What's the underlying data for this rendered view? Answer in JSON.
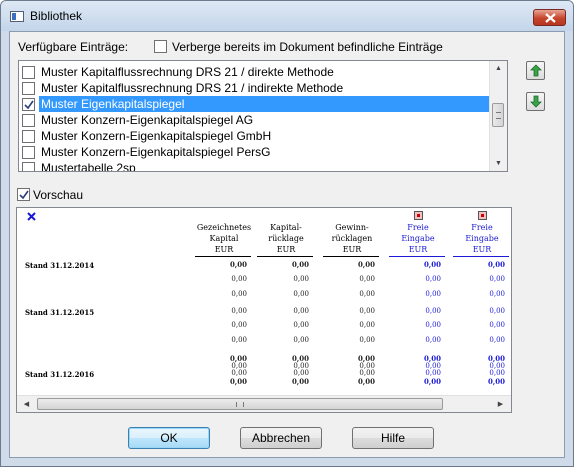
{
  "window": {
    "title": "Bibliothek"
  },
  "header": {
    "available_label": "Verfügbare Einträge:",
    "hide_label": "Verberge bereits im Dokument befindliche Einträge",
    "hide_checked": false
  },
  "list": {
    "items": [
      {
        "label": "Muster Kapitalflussrechnung DRS 21 / direkte Methode",
        "checked": false,
        "selected": false
      },
      {
        "label": "Muster Kapitalflussrechnung DRS 21 / indirekte Methode",
        "checked": false,
        "selected": false
      },
      {
        "label": "Muster Eigenkapitalspiegel",
        "checked": true,
        "selected": true
      },
      {
        "label": "Muster Konzern-Eigenkapitalspiegel AG",
        "checked": false,
        "selected": false
      },
      {
        "label": "Muster Konzern-Eigenkapitalspiegel GmbH",
        "checked": false,
        "selected": false
      },
      {
        "label": "Muster Konzern-Eigenkapitalspiegel PersG",
        "checked": false,
        "selected": false
      },
      {
        "label": "Mustertabelle 2sp",
        "checked": false,
        "selected": false
      }
    ]
  },
  "preview": {
    "label": "Vorschau",
    "checked": true,
    "columns": [
      {
        "l1": "Gezeichnetes",
        "l2": "Kapital",
        "unit": "EUR",
        "blue": false
      },
      {
        "l1": "Kapital-",
        "l2": "rücklage",
        "unit": "EUR",
        "blue": false
      },
      {
        "l1": "Gewinn-",
        "l2": "rücklagen",
        "unit": "EUR",
        "blue": false
      },
      {
        "l1": "Freie",
        "l2": "Eingabe",
        "unit": "EUR",
        "blue": true
      },
      {
        "l1": "Freie",
        "l2": "Eingabe",
        "unit": "EUR",
        "blue": true
      }
    ],
    "row_labels": [
      "Stand 31.12.2014",
      "Stand 31.12.2015",
      "Stand 31.12.2016"
    ],
    "zero_value": "0,00"
  },
  "buttons": {
    "ok": "OK",
    "cancel": "Abbrechen",
    "help": "Hilfe"
  },
  "colors": {
    "selection": "#3399ff",
    "free_entry": "#1a1ad6",
    "close": "#c5452c"
  }
}
